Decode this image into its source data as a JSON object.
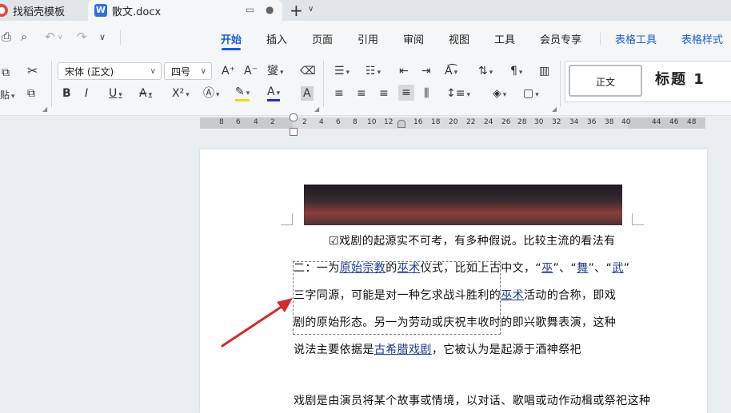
{
  "tabs": [
    {
      "label": "找稻壳模板",
      "icon": "wps-logo-icon"
    },
    {
      "label": "散文.docx",
      "icon": "word-doc-icon",
      "icon_letter": "W"
    }
  ],
  "toolbar_menu": [
    "开始",
    "插入",
    "页面",
    "引用",
    "审阅",
    "视图",
    "工具",
    "会员专享"
  ],
  "context_tabs": [
    "表格工具",
    "表格样式"
  ],
  "font": {
    "name": "宋体 (正文)",
    "size": "四号"
  },
  "format_buttons": {
    "bold": "B",
    "italic": "I",
    "underline": "U",
    "strike": "A",
    "superscript": "X²",
    "bigger": "A⁺",
    "smaller": "A⁻"
  },
  "styles": {
    "normal": "正文",
    "heading1": "标题  1"
  },
  "ruler_ticks": [
    "8",
    "6",
    "4",
    "2",
    "2",
    "4",
    "6",
    "8",
    "10",
    "12",
    "16",
    "18",
    "20",
    "22",
    "24",
    "26",
    "28",
    "30",
    "32",
    "34",
    "36",
    "38",
    "40",
    "44",
    "46",
    "48"
  ],
  "document": {
    "line1": "☑戏剧的起源实不可考，有多种假说。比较主流的看法有",
    "line2_pre": "二：一为",
    "line2_link1": "原始宗教",
    "line2_mid1": "的",
    "line2_link2": "巫术",
    "line2_mid2": "仪式，比如上古中文，“",
    "line2_link3": "巫",
    "line2_mid3": "”、“",
    "line2_link4": "舞",
    "line2_mid4": "”、“",
    "line2_link5": "武",
    "line2_end": "”",
    "line3_pre": "三字同源，可能是对一种乞求战斗胜利的",
    "line3_link": "巫术",
    "line3_end": "活动的合称，即戏",
    "line4": "剧的原始形态。另一为劳动或庆祝丰收时的即兴歌舞表演，这种",
    "line5_pre": "说法主要依据是",
    "line5_link": "古希腊戏剧",
    "line5_end": "，它被认为是起源于酒神祭祀",
    "line6": "戏剧是由演员将某个故事或情境，以对话、歌唱或动作动楫或祭祀这种"
  }
}
